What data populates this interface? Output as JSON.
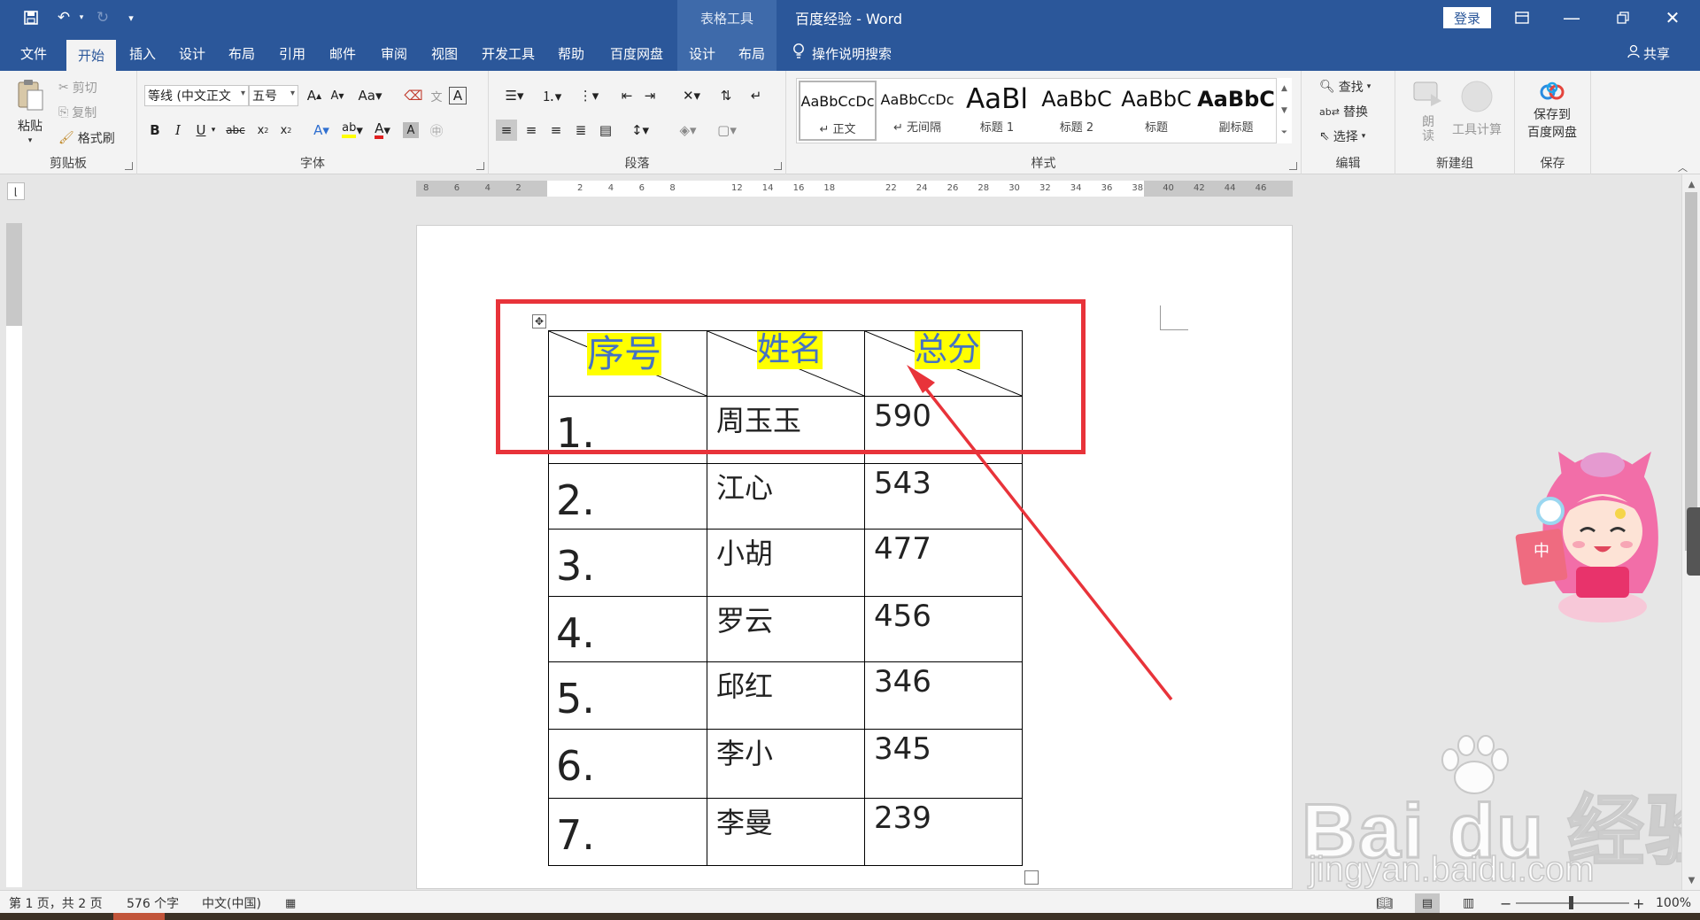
{
  "title_bar": {
    "save_icon": "save-icon",
    "context_tab_title": "表格工具",
    "document_title": "百度经验  -  Word",
    "login_label": "登录"
  },
  "tabs": [
    {
      "label": "文件",
      "active": false
    },
    {
      "label": "开始",
      "active": true
    },
    {
      "label": "插入",
      "active": false
    },
    {
      "label": "设计",
      "active": false
    },
    {
      "label": "布局",
      "active": false
    },
    {
      "label": "引用",
      "active": false
    },
    {
      "label": "邮件",
      "active": false
    },
    {
      "label": "审阅",
      "active": false
    },
    {
      "label": "视图",
      "active": false
    },
    {
      "label": "开发工具",
      "active": false
    },
    {
      "label": "帮助",
      "active": false
    },
    {
      "label": "百度网盘",
      "active": false
    }
  ],
  "context_tabs": [
    "设计",
    "布局"
  ],
  "tell_me": "操作说明搜索",
  "share_label": "共享",
  "ribbon": {
    "clipboard": {
      "label": "剪贴板",
      "paste": "粘贴",
      "cut": "剪切",
      "copy": "复制",
      "format_painter": "格式刷"
    },
    "font": {
      "label": "字体",
      "font_name": "等线 (中文正文",
      "font_size": "五号"
    },
    "paragraph": {
      "label": "段落"
    },
    "styles": {
      "label": "样式",
      "items": [
        {
          "sample": "AaBbCcDc",
          "name": "↵ 正文"
        },
        {
          "sample": "AaBbCcDc",
          "name": "↵ 无间隔"
        },
        {
          "sample": "AaBl",
          "name": "标题 1"
        },
        {
          "sample": "AaBbC",
          "name": "标题 2"
        },
        {
          "sample": "AaBbC",
          "name": "标题"
        },
        {
          "sample": "AaBbC",
          "name": "副标题"
        }
      ]
    },
    "editing": {
      "label": "编辑",
      "find": "查找",
      "replace": "替换",
      "select": "选择"
    },
    "new_group": {
      "label": "新建组",
      "read_aloud": "朗读",
      "tool_calc": "工具计算"
    },
    "save_group": {
      "label": "保存",
      "save_to_baidu_line1": "保存到",
      "save_to_baidu_line2": "百度网盘"
    }
  },
  "ruler_marks": [
    "8",
    "6",
    "4",
    "2",
    "",
    "2",
    "4",
    "6",
    "8",
    "",
    "12",
    "14",
    "16",
    "18",
    "",
    "22",
    "24",
    "26",
    "28",
    "30",
    "32",
    "34",
    "36",
    "38",
    "40",
    "42",
    "44",
    "46"
  ],
  "table": {
    "header": {
      "col1": "序号",
      "col2": "姓名",
      "col3": "总分"
    },
    "rows": [
      {
        "num": "1.",
        "name": "周玉玉",
        "score": "590"
      },
      {
        "num": "2.",
        "name": "江心",
        "score": "543"
      },
      {
        "num": "3.",
        "name": "小胡",
        "score": "477"
      },
      {
        "num": "4.",
        "name": "罗云",
        "score": "456"
      },
      {
        "num": "5.",
        "name": "邱红",
        "score": "346"
      },
      {
        "num": "6.",
        "name": "李小",
        "score": "345"
      },
      {
        "num": "7.",
        "name": "李曼",
        "score": "239"
      }
    ]
  },
  "status_bar": {
    "page_info": "第 1 页，共 2 页",
    "word_count": "576 个字",
    "language": "中文(中国)",
    "zoom": "100%"
  },
  "watermark": {
    "brand": "Bai du 经验",
    "url": "jingyan.baidu.com"
  },
  "colors": {
    "title_bar": "#2b579a",
    "highlight": "#ffff00",
    "header_text": "#4472c4",
    "annotation_red": "#e8333a"
  }
}
